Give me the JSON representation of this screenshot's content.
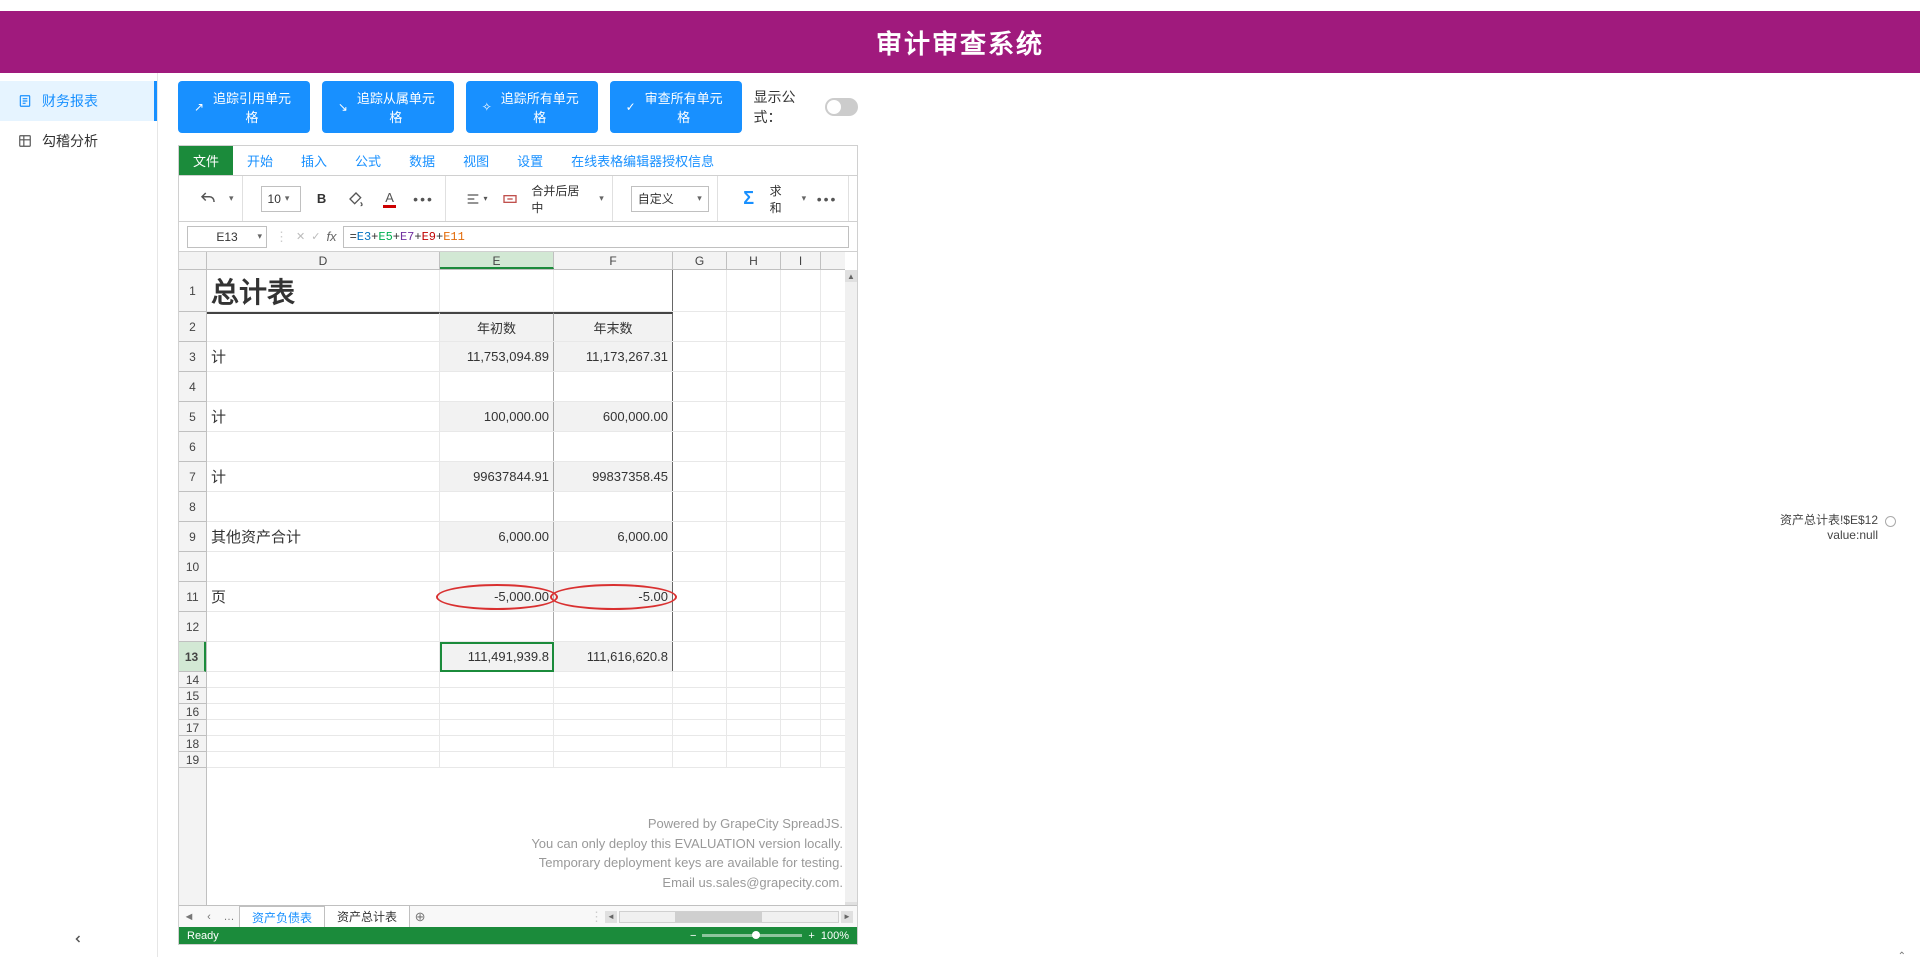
{
  "header": {
    "title": "审计审查系统"
  },
  "sidebar": {
    "items": [
      {
        "label": "财务报表"
      },
      {
        "label": "勾稽分析"
      }
    ]
  },
  "toolbar": {
    "trace_precedents": "追踪引用单元格",
    "trace_dependents": "追踪从属单元格",
    "trace_all": "追踪所有单元格",
    "review_all": "审查所有单元格",
    "show_formula_label": "显示公式："
  },
  "ribbon": {
    "tabs": [
      "文件",
      "开始",
      "插入",
      "公式",
      "数据",
      "视图",
      "设置",
      "在线表格编辑器授权信息"
    ],
    "font_size": "10",
    "merge_label": "合并后居中",
    "number_format": "自定义",
    "autosum": "求和"
  },
  "formula_bar": {
    "cell_ref": "E13",
    "formula_prefix": "=",
    "parts": [
      "E3",
      "+",
      "E5",
      "+",
      "E7",
      "+",
      "E9",
      "+",
      "E11"
    ]
  },
  "columns": [
    "D",
    "E",
    "F",
    "G",
    "H",
    "I"
  ],
  "rows_visible": [
    1,
    2,
    3,
    4,
    5,
    6,
    7,
    8,
    9,
    10,
    11,
    12,
    13,
    14,
    15,
    16,
    17,
    18,
    19
  ],
  "sheet": {
    "title_fragment": "总计表",
    "col_widths": {
      "D": 233,
      "E": 114,
      "F": 119,
      "G": 54,
      "H": 54,
      "I": 40
    },
    "row_heights": {
      "1": 42,
      "default": 30,
      "tail": 16
    },
    "headers": {
      "E2": "年初数",
      "F2": "年末数"
    },
    "labels": {
      "D3": "计",
      "D5": "计",
      "D7": "计",
      "D9": "其他资产合计",
      "D11": "页"
    },
    "data": {
      "E3": "11,753,094.89",
      "F3": "11,173,267.31",
      "E5": "100,000.00",
      "F5": "600,000.00",
      "E7": "99637844.91",
      "F7": "99837358.45",
      "E9": "6,000.00",
      "F9": "6,000.00",
      "E11": "-5,000.00",
      "F11": "-5.00",
      "E13": "111,491,939.8",
      "F13": "111,616,620.8"
    }
  },
  "sheet_tabs": [
    "资产负债表",
    "资产总计表"
  ],
  "status": {
    "ready": "Ready",
    "zoom": "100%"
  },
  "watermark": {
    "l1": "Powered by GrapeCity SpreadJS.",
    "l2": "You can only deploy this EVALUATION version locally.",
    "l3": "Temporary deployment keys are available for testing.",
    "l4": "Email us.sales@grapecity.com."
  },
  "node": {
    "ref": "资产总计表!$E$12",
    "value": "value:null"
  }
}
